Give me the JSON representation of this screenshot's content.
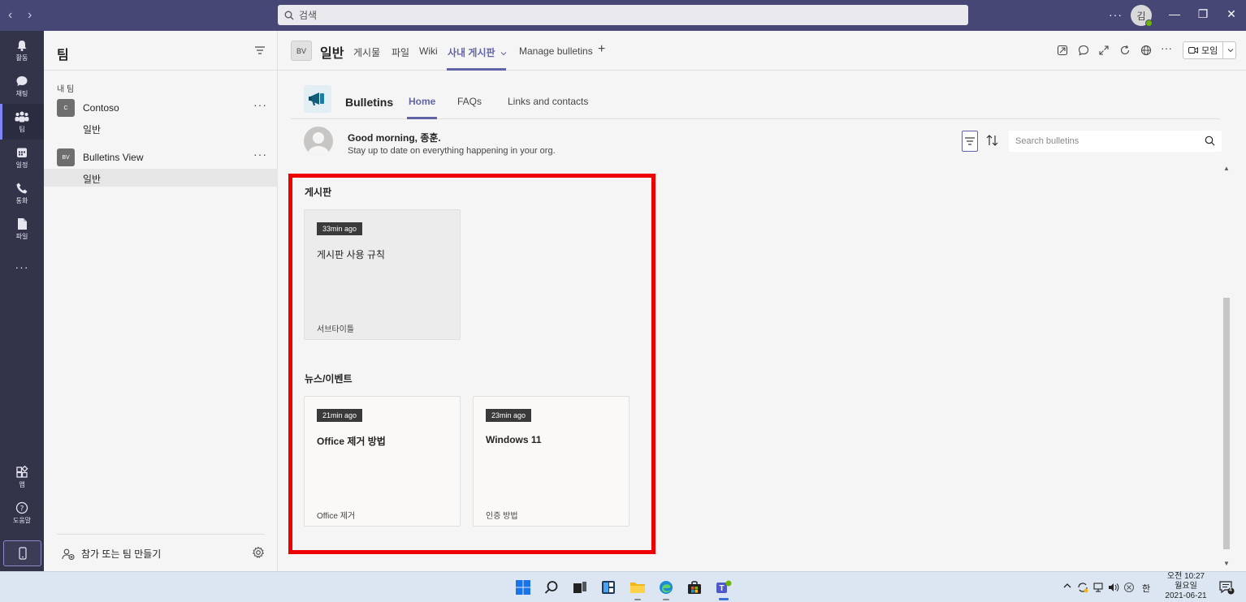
{
  "titlebar": {
    "search_placeholder": "검색",
    "avatar_initial": "김",
    "more": "···",
    "back_arrow": "‹",
    "forward_arrow": "›",
    "minimize": "—",
    "maximize": "❐",
    "close": "✕"
  },
  "rail": {
    "items": [
      {
        "label": "활동",
        "icon": "bell-icon"
      },
      {
        "label": "채팅",
        "icon": "chat-icon"
      },
      {
        "label": "팀",
        "icon": "teams-icon"
      },
      {
        "label": "일정",
        "icon": "calendar-icon"
      },
      {
        "label": "통화",
        "icon": "phone-icon"
      },
      {
        "label": "파일",
        "icon": "file-icon"
      }
    ],
    "more": "···",
    "apps_label": "앱",
    "help_label": "도움말"
  },
  "teams_panel": {
    "title": "팀",
    "section": "내 팀",
    "teams": [
      {
        "initials": "C",
        "name": "Contoso",
        "more": "···",
        "channels": [
          "일반"
        ]
      },
      {
        "initials": "BV",
        "name": "Bulletins View",
        "more": "···",
        "channels": [
          "일반"
        ]
      }
    ],
    "join_create": "참가 또는 팀 만들기"
  },
  "channel_header": {
    "team_initials": "BV",
    "channel_name": "일반",
    "tabs": [
      "게시물",
      "파일",
      "Wiki",
      "사내 게시판",
      "Manage bulletins"
    ],
    "active_tab": "사내 게시판",
    "add_tab": "+",
    "meet_label": "모임"
  },
  "bulletins_app": {
    "name": "Bulletins",
    "tabs": [
      "Home",
      "FAQs",
      "Links and contacts"
    ],
    "active_tab": "Home",
    "greeting": "Good morning, 종훈.",
    "greeting_sub": "Stay up to date on everything happening in your org.",
    "search_placeholder": "Search bulletins",
    "sections": [
      {
        "title": "게시판",
        "cards": [
          {
            "time": "33min ago",
            "title": "게시판 사용 규칙",
            "subtitle": "서브타이틀"
          }
        ]
      },
      {
        "title": "뉴스/이벤트",
        "cards": [
          {
            "time": "21min ago",
            "title": "Office 제거 방법",
            "subtitle": "Office 제거"
          },
          {
            "time": "23min ago",
            "title": "Windows 11",
            "subtitle": "인증 방법"
          }
        ]
      }
    ],
    "highlight_color": "#ee0000"
  },
  "taskbar": {
    "clock_time": "오전 10:27",
    "clock_day": "월요일",
    "clock_date": "2021-06-21",
    "ime": "한",
    "notification_count": "4"
  },
  "colors": {
    "accent": "#6264a7",
    "titlebar": "#464775",
    "rail": "#33344a"
  }
}
